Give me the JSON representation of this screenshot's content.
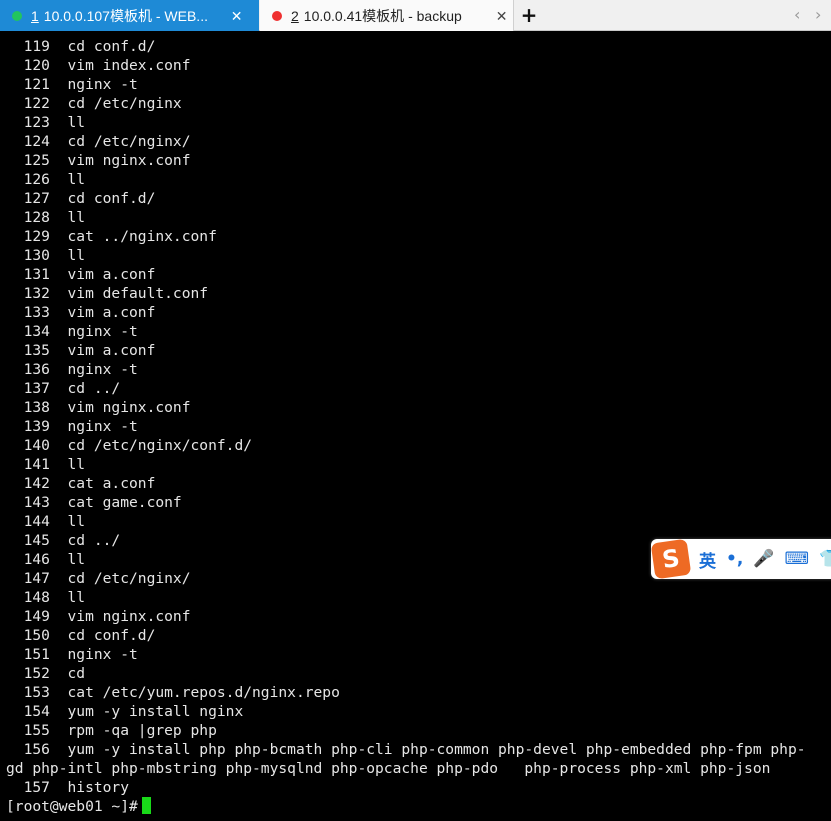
{
  "tabs": [
    {
      "index": "1",
      "title": "10.0.0.107模板机 - WEB...",
      "status_color": "#22c55e",
      "close": "✕",
      "active": true
    },
    {
      "index": "2",
      "title": "10.0.0.41模板机 - backup",
      "status_color": "#ef3030",
      "close": "✕",
      "active": false
    }
  ],
  "new_tab": "+",
  "nav": {
    "prev": "‹",
    "next": "›"
  },
  "terminal": {
    "lines": [
      "  119  cd conf.d/",
      "  120  vim index.conf",
      "  121  nginx -t",
      "  122  cd /etc/nginx",
      "  123  ll",
      "  124  cd /etc/nginx/",
      "  125  vim nginx.conf",
      "  126  ll",
      "  127  cd conf.d/",
      "  128  ll",
      "  129  cat ../nginx.conf",
      "  130  ll",
      "  131  vim a.conf",
      "  132  vim default.conf",
      "  133  vim a.conf",
      "  134  nginx -t",
      "  135  vim a.conf",
      "  136  nginx -t",
      "  137  cd ../",
      "  138  vim nginx.conf",
      "  139  nginx -t",
      "  140  cd /etc/nginx/conf.d/",
      "  141  ll",
      "  142  cat a.conf",
      "  143  cat game.conf",
      "  144  ll",
      "  145  cd ../",
      "  146  ll",
      "  147  cd /etc/nginx/",
      "  148  ll",
      "  149  vim nginx.conf",
      "  150  cd conf.d/",
      "  151  nginx -t",
      "  152  cd",
      "  153  cat /etc/yum.repos.d/nginx.repo",
      "  154  yum -y install nginx",
      "  155  rpm -qa |grep php",
      "  156  yum -y install php php-bcmath php-cli php-common php-devel php-embedded php-fpm php-",
      "gd php-intl php-mbstring php-mysqlnd php-opcache php-pdo   php-process php-xml php-json",
      "  157  history"
    ],
    "prompt": "[root@web01 ~]#",
    "cursor_color": "#19d919"
  },
  "ime": {
    "logo": "S",
    "items": [
      "英",
      "•,",
      "🎤",
      "⌨",
      "👕"
    ]
  }
}
